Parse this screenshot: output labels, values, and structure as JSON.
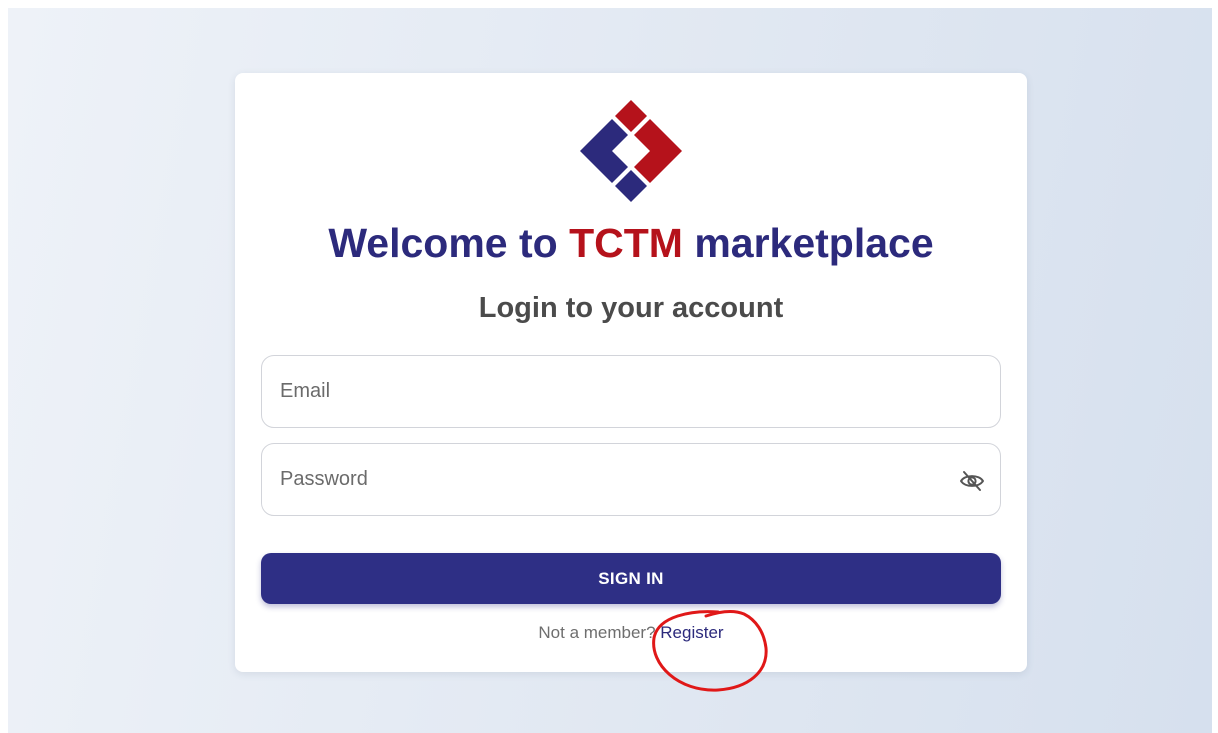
{
  "login": {
    "title_prefix": "Welcome to ",
    "title_brand": "TCTM",
    "title_suffix": " marketplace",
    "subtitle": "Login to your account",
    "email_placeholder": "Email",
    "password_placeholder": "Password",
    "signin_label": "SIGN IN",
    "member_prompt": "Not a member? ",
    "register_label": "Register"
  },
  "icons": {
    "logo": "tctm-diamond-logo",
    "password_toggle": "eye-slash-icon"
  },
  "colors": {
    "brand_navy": "#2c2a7c",
    "brand_red": "#b5121b",
    "button_bg": "#2e2f85",
    "annotation_red": "#e01818"
  }
}
